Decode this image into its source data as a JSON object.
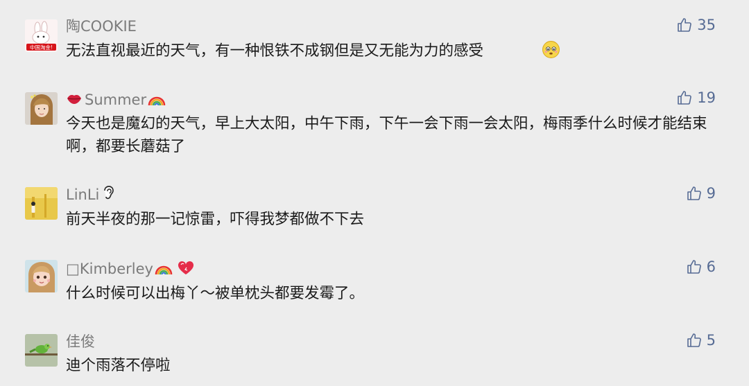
{
  "comments": [
    {
      "username": "陶COOKIE",
      "text": "无法直视最近的天气，有一种恨铁不成钢但是又无能为力的感受",
      "likes": "35",
      "avatar_label": "中国淘金!"
    },
    {
      "username": "Summer",
      "text": "今天也是魔幻的天气，早上大太阳，中午下雨，下午一会下雨一会太阳，梅雨季什么时候才能结束啊，都要长蘑菇了",
      "likes": "19"
    },
    {
      "username": "LinLi",
      "text": "前天半夜的那一记惊雷，吓得我梦都做不下去",
      "likes": "9"
    },
    {
      "username": "Kimberley",
      "name_prefix": "□",
      "text": "什么时候可以出梅丫～被单枕头都要发霉了。",
      "likes": "6"
    },
    {
      "username": "佳俊",
      "text": "迪个雨落不停啦",
      "likes": "5"
    }
  ],
  "colors": {
    "background": "#ededed",
    "username": "#7b7b7b",
    "text": "#1a1a1a",
    "like": "#566b94"
  },
  "icons": {
    "like": "thumbs-up-icon",
    "emojis": [
      "worried-face-icon",
      "lips-icon",
      "rainbow-icon",
      "ear-icon",
      "heart-icon"
    ]
  }
}
